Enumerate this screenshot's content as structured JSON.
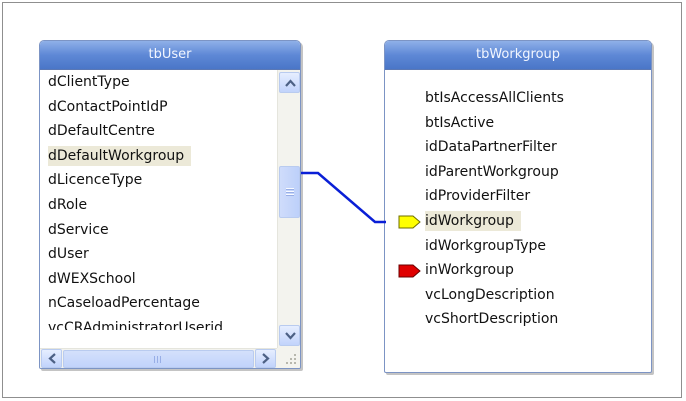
{
  "tb_user": {
    "title": "tbUser",
    "columns": [
      {
        "label": "dClientType",
        "selected": false
      },
      {
        "label": "dContactPointIdP",
        "selected": false
      },
      {
        "label": "dDefaultCentre",
        "selected": false
      },
      {
        "label": "dDefaultWorkgroup",
        "selected": true
      },
      {
        "label": "dLicenceType",
        "selected": false
      },
      {
        "label": "dRole",
        "selected": false
      },
      {
        "label": "dService",
        "selected": false
      },
      {
        "label": "dUser",
        "selected": false
      },
      {
        "label": "dWEXSchool",
        "selected": false
      },
      {
        "label": "nCaseloadPercentage",
        "selected": false
      },
      {
        "label": "vcCRAdministratorUserid",
        "selected": false
      }
    ]
  },
  "tb_workgroup": {
    "title": "tbWorkgroup",
    "columns": [
      {
        "label": "btIsAccessAllClients",
        "key": "none"
      },
      {
        "label": "btIsActive",
        "key": "none"
      },
      {
        "label": "idDataPartnerFilter",
        "key": "none"
      },
      {
        "label": "idParentWorkgroup",
        "key": "none"
      },
      {
        "label": "idProviderFilter",
        "key": "none"
      },
      {
        "label": "idWorkgroup",
        "key": "primary"
      },
      {
        "label": "idWorkgroupType",
        "key": "none"
      },
      {
        "label": "inWorkgroup",
        "key": "foreign"
      },
      {
        "label": "vcLongDescription",
        "key": "none"
      },
      {
        "label": "vcShortDescription",
        "key": "none"
      }
    ]
  },
  "relationship": {
    "from": "dDefaultWorkgroup",
    "to": "idWorkgroup",
    "color": "#0a1fd6"
  },
  "colors": {
    "title_bar": "#5e88d6",
    "primary_key_marker": "#ffff00",
    "foreign_key_marker": "#e00000",
    "selected_row_bg": "#ece9d8"
  },
  "icons": {
    "scroll_up": "chevron-up-icon",
    "scroll_down": "chevron-down-icon",
    "scroll_left": "chevron-left-icon",
    "scroll_right": "chevron-right-icon",
    "key_marker": "key-marker-icon",
    "resize_grip": "resize-grip-icon"
  }
}
